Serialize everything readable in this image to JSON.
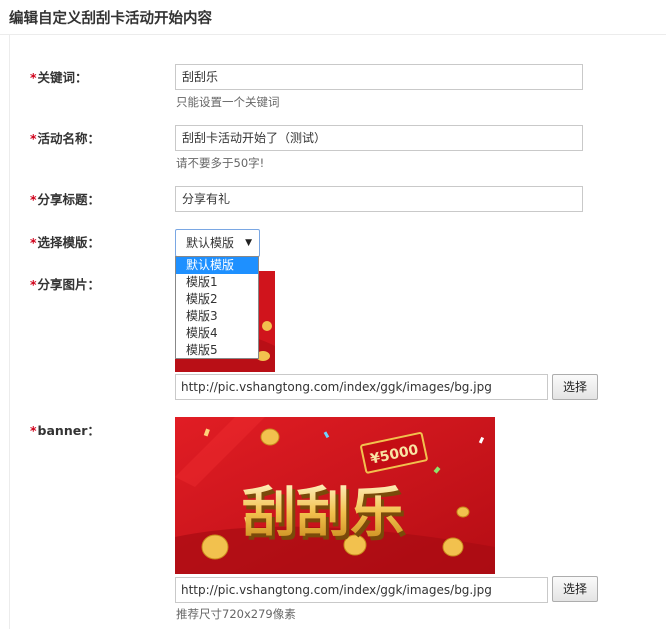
{
  "page_title": "编辑自定义刮刮卡活动开始内容",
  "required_mark": "*",
  "form": {
    "keyword": {
      "label": "关键词：",
      "value": "刮刮乐",
      "help": "只能设置一个关键词"
    },
    "activity_name": {
      "label": "活动名称：",
      "value": "刮刮卡活动开始了（测试）",
      "help": "请不要多于50字!"
    },
    "share_title": {
      "label": "分享标题：",
      "value": "分享有礼"
    },
    "template": {
      "label": "选择模版：",
      "selected": "默认模版",
      "options": [
        "默认模版",
        "模版1",
        "模版2",
        "模版3",
        "模版4",
        "模版5"
      ]
    },
    "share_image": {
      "label": "分享图片：",
      "url": "http://pic.vshangtong.com/index/ggk/images/bg.jpg",
      "button": "选择"
    },
    "banner": {
      "label": "banner：",
      "url": "http://pic.vshangtong.com/index/ggk/images/bg.jpg",
      "button": "选择",
      "help": "推荐尺寸720x279像素",
      "image_text": {
        "title": "刮刮乐",
        "ticket": "¥5000"
      }
    }
  },
  "colors": {
    "accent": "#1e90ff",
    "required": "#d0021b",
    "banner_red": "#d0141c",
    "gold": "#f2c14e"
  },
  "icons": {
    "select_arrow": "triangle-down-icon"
  }
}
